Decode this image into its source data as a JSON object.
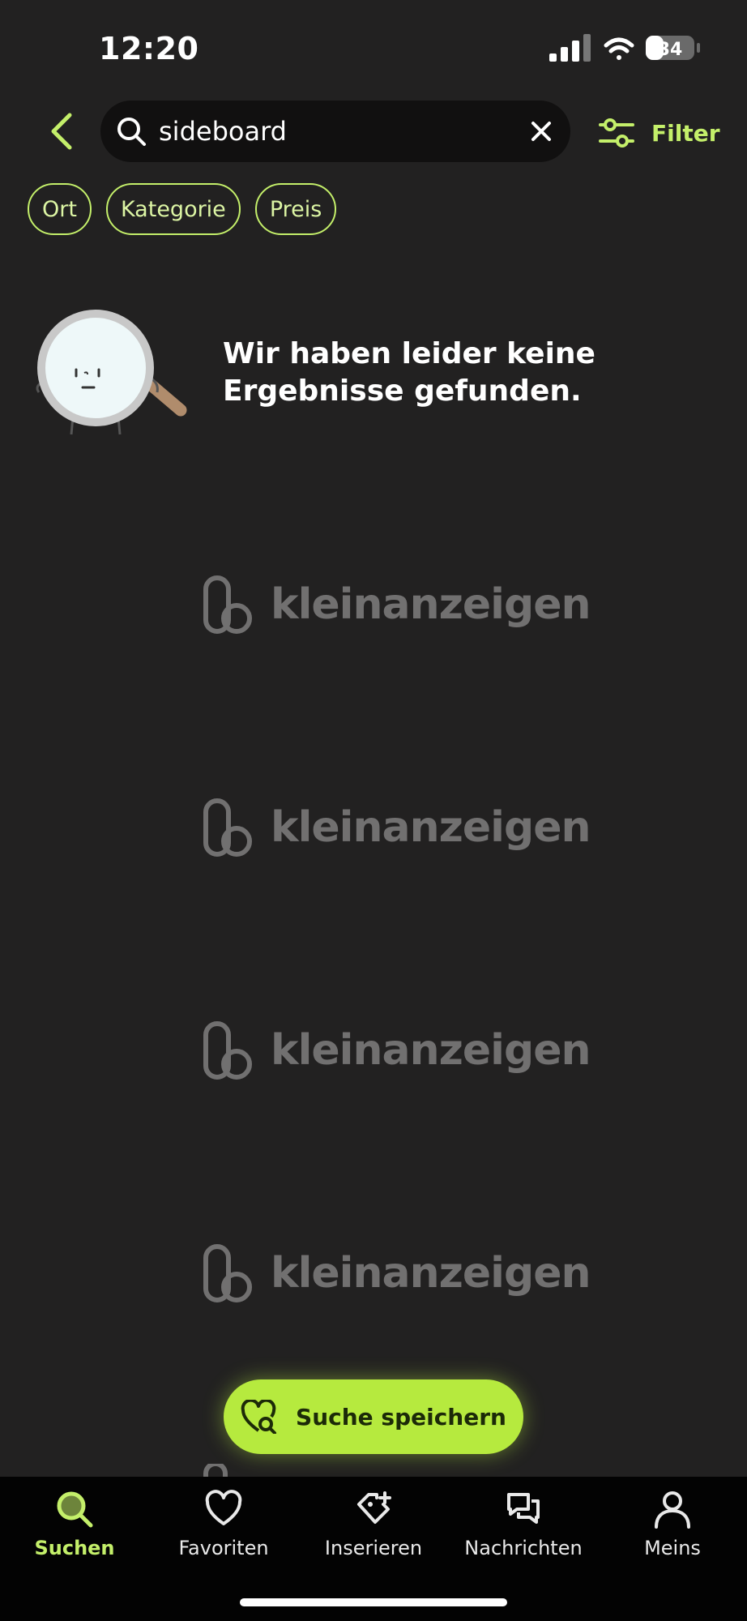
{
  "status_bar": {
    "time": "12:20",
    "battery": "34"
  },
  "search": {
    "query": "sideboard",
    "placeholder": ""
  },
  "filter": {
    "label": "Filter"
  },
  "chips": [
    {
      "label": "Ort"
    },
    {
      "label": "Kategorie"
    },
    {
      "label": "Preis"
    }
  ],
  "empty_state": {
    "line1": "Wir haben leider keine",
    "line2": "Ergebnisse gefunden."
  },
  "brand": {
    "wordmark": "kleinanzeigen"
  },
  "save_search": {
    "label": "Suche speichern"
  },
  "tabbar": {
    "items": [
      {
        "label": "Suchen",
        "icon": "search-icon",
        "active": true
      },
      {
        "label": "Favoriten",
        "icon": "heart-icon",
        "active": false
      },
      {
        "label": "Inserieren",
        "icon": "tag-plus-icon",
        "active": false
      },
      {
        "label": "Nachrichten",
        "icon": "chat-icon",
        "active": false
      },
      {
        "label": "Meins",
        "icon": "person-icon",
        "active": false
      }
    ]
  },
  "colors": {
    "background": "#222121",
    "accent": "#c4ef6a",
    "button": "#b6ea3e",
    "tabbar": "#030303",
    "placeholder_logo": "#717070"
  }
}
